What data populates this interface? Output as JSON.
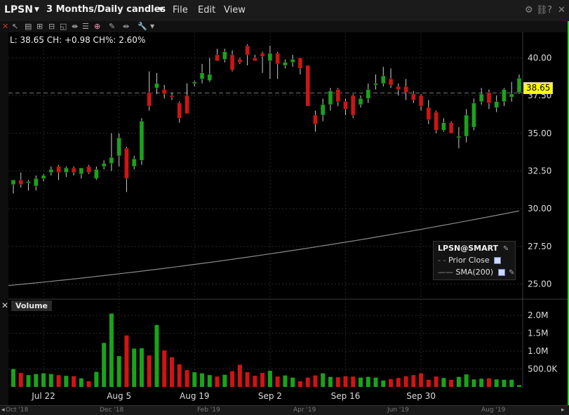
{
  "header": {
    "symbol": "LPSN",
    "period": "3 Months/Daily candles",
    "menus": [
      "File",
      "Edit",
      "View"
    ],
    "icons": [
      "gear-icon",
      "link-icon",
      "help-icon",
      "close-icon"
    ]
  },
  "toolbar": {
    "icons": [
      "close-icon",
      "cursor-icon",
      "bar-type-icon",
      "zoom-in-icon",
      "zoom-out-icon",
      "crosshair-icon",
      "annotation-icon",
      "split-icon",
      "tools-icon",
      "dropdown-icon"
    ]
  },
  "ohlc_readout": "L: 38.65 CH: +0.98 CH%: 2.60%",
  "last_price_tag": "38.65",
  "legend": {
    "title": "LPSN@SMART",
    "prior_close": "Prior Close",
    "sma": "SMA(200)"
  },
  "volume_label": "Volume",
  "timeline": {
    "labels": [
      "Oct '18",
      "Dec '18",
      "Feb '19",
      "Apr '19",
      "Jun '19",
      "Aug '19"
    ]
  },
  "colors": {
    "up": "#1aa31a",
    "down": "#d01414",
    "price_tag": "#ffff00",
    "sma": "#888888",
    "right_edge": "#22e022"
  },
  "chart_data": {
    "type": "candlestick",
    "price_axis": {
      "min": 24,
      "max": 41.6,
      "ticks": [
        "25.00",
        "27.50",
        "30.00",
        "32.50",
        "35.00",
        "37.50",
        "40.00"
      ]
    },
    "volume_axis": {
      "min": 0,
      "max": 2100000,
      "ticks": [
        "500.0K",
        "1.0M",
        "1.5M",
        "2.0M"
      ]
    },
    "x_labels": [
      "Jul 22",
      "Aug 5",
      "Aug 19",
      "Sep 2",
      "Sep 16",
      "Sep 30"
    ],
    "x_label_index": [
      4,
      14,
      24,
      34,
      44,
      54
    ],
    "prior_close": 37.67,
    "sma200": {
      "start": 24.9,
      "end": 29.85
    },
    "candles": [
      {
        "o": 31.6,
        "h": 31.8,
        "l": 31.0,
        "c": 31.9,
        "v": 500000
      },
      {
        "o": 31.9,
        "h": 32.4,
        "l": 31.4,
        "c": 31.6,
        "v": 390000
      },
      {
        "o": 31.7,
        "h": 31.9,
        "l": 31.2,
        "c": 31.8,
        "v": 330000
      },
      {
        "o": 31.5,
        "h": 32.2,
        "l": 31.2,
        "c": 32.0,
        "v": 360000
      },
      {
        "o": 32.0,
        "h": 32.3,
        "l": 31.8,
        "c": 32.2,
        "v": 380000
      },
      {
        "o": 32.4,
        "h": 32.8,
        "l": 32.2,
        "c": 32.6,
        "v": 360000
      },
      {
        "o": 32.8,
        "h": 32.9,
        "l": 31.9,
        "c": 32.4,
        "v": 330000
      },
      {
        "o": 32.4,
        "h": 32.8,
        "l": 32.1,
        "c": 32.7,
        "v": 310000
      },
      {
        "o": 32.7,
        "h": 32.8,
        "l": 32.2,
        "c": 32.4,
        "v": 300000
      },
      {
        "o": 32.3,
        "h": 32.7,
        "l": 32.0,
        "c": 32.7,
        "v": 240000
      },
      {
        "o": 32.8,
        "h": 32.9,
        "l": 32.3,
        "c": 32.4,
        "v": 160000
      },
      {
        "o": 32.0,
        "h": 32.8,
        "l": 31.9,
        "c": 32.6,
        "v": 420000
      },
      {
        "o": 32.8,
        "h": 33.2,
        "l": 32.6,
        "c": 33.0,
        "v": 1230000
      },
      {
        "o": 33.0,
        "h": 35.0,
        "l": 32.5,
        "c": 33.4,
        "v": 2050000
      },
      {
        "o": 33.5,
        "h": 35.0,
        "l": 32.8,
        "c": 34.7,
        "v": 860000
      },
      {
        "o": 34.0,
        "h": 34.1,
        "l": 31.1,
        "c": 32.0,
        "v": 1440000
      },
      {
        "o": 32.8,
        "h": 33.5,
        "l": 32.6,
        "c": 33.3,
        "v": 1070000
      },
      {
        "o": 33.2,
        "h": 36.0,
        "l": 32.9,
        "c": 35.8,
        "v": 1080000
      },
      {
        "o": 37.7,
        "h": 39.1,
        "l": 36.5,
        "c": 36.8,
        "v": 880000
      },
      {
        "o": 38.0,
        "h": 39.0,
        "l": 37.6,
        "c": 38.3,
        "v": 1730000
      },
      {
        "o": 37.9,
        "h": 38.2,
        "l": 37.3,
        "c": 37.6,
        "v": 1020000
      },
      {
        "o": 37.5,
        "h": 37.7,
        "l": 37.2,
        "c": 37.4,
        "v": 830000
      },
      {
        "o": 37.0,
        "h": 37.1,
        "l": 35.7,
        "c": 36.0,
        "v": 630000
      },
      {
        "o": 37.5,
        "h": 38.3,
        "l": 36.3,
        "c": 36.3,
        "v": 470000
      },
      {
        "o": 38.3,
        "h": 38.5,
        "l": 38.1,
        "c": 38.4,
        "v": 410000
      },
      {
        "o": 38.6,
        "h": 39.6,
        "l": 38.3,
        "c": 39.0,
        "v": 380000
      },
      {
        "o": 38.5,
        "h": 40.0,
        "l": 38.4,
        "c": 38.9,
        "v": 330000
      },
      {
        "o": 40.2,
        "h": 40.6,
        "l": 39.8,
        "c": 39.8,
        "v": 290000
      },
      {
        "o": 39.9,
        "h": 40.6,
        "l": 39.7,
        "c": 40.4,
        "v": 340000
      },
      {
        "o": 40.2,
        "h": 40.5,
        "l": 39.1,
        "c": 39.2,
        "v": 440000
      },
      {
        "o": 39.9,
        "h": 40.0,
        "l": 39.6,
        "c": 39.7,
        "v": 620000
      },
      {
        "o": 40.8,
        "h": 40.9,
        "l": 39.5,
        "c": 40.2,
        "v": 410000
      },
      {
        "o": 40.0,
        "h": 40.2,
        "l": 39.9,
        "c": 39.8,
        "v": 310000
      },
      {
        "o": 40.3,
        "h": 40.4,
        "l": 39.0,
        "c": 40.1,
        "v": 390000
      },
      {
        "o": 39.8,
        "h": 40.8,
        "l": 38.6,
        "c": 40.3,
        "v": 450000
      },
      {
        "o": 40.3,
        "h": 40.4,
        "l": 38.6,
        "c": 39.6,
        "v": 290000
      },
      {
        "o": 39.5,
        "h": 39.9,
        "l": 39.3,
        "c": 39.7,
        "v": 320000
      },
      {
        "o": 39.7,
        "h": 40.2,
        "l": 39.4,
        "c": 39.9,
        "v": 260000
      },
      {
        "o": 40.0,
        "h": 40.0,
        "l": 38.9,
        "c": 39.3,
        "v": 160000
      },
      {
        "o": 39.5,
        "h": 39.5,
        "l": 36.8,
        "c": 36.8,
        "v": 260000
      },
      {
        "o": 36.2,
        "h": 36.5,
        "l": 35.1,
        "c": 35.6,
        "v": 320000
      },
      {
        "o": 36.2,
        "h": 37.3,
        "l": 35.8,
        "c": 36.9,
        "v": 380000
      },
      {
        "o": 36.9,
        "h": 38.0,
        "l": 36.5,
        "c": 37.8,
        "v": 280000
      },
      {
        "o": 37.9,
        "h": 38.0,
        "l": 36.8,
        "c": 37.1,
        "v": 270000
      },
      {
        "o": 37.1,
        "h": 37.3,
        "l": 36.2,
        "c": 36.6,
        "v": 300000
      },
      {
        "o": 37.5,
        "h": 37.6,
        "l": 36.0,
        "c": 36.2,
        "v": 290000
      },
      {
        "o": 36.9,
        "h": 37.5,
        "l": 36.7,
        "c": 37.3,
        "v": 260000
      },
      {
        "o": 37.3,
        "h": 38.3,
        "l": 37.0,
        "c": 37.9,
        "v": 280000
      },
      {
        "o": 38.2,
        "h": 38.9,
        "l": 37.9,
        "c": 38.3,
        "v": 260000
      },
      {
        "o": 38.3,
        "h": 39.4,
        "l": 38.1,
        "c": 38.8,
        "v": 180000
      },
      {
        "o": 38.6,
        "h": 39.3,
        "l": 38.0,
        "c": 38.2,
        "v": 220000
      },
      {
        "o": 38.1,
        "h": 38.3,
        "l": 37.5,
        "c": 37.9,
        "v": 250000
      },
      {
        "o": 38.1,
        "h": 38.6,
        "l": 37.2,
        "c": 37.7,
        "v": 300000
      },
      {
        "o": 37.6,
        "h": 37.8,
        "l": 37.0,
        "c": 37.2,
        "v": 330000
      },
      {
        "o": 37.5,
        "h": 37.6,
        "l": 36.5,
        "c": 36.8,
        "v": 380000
      },
      {
        "o": 36.7,
        "h": 37.2,
        "l": 35.6,
        "c": 35.9,
        "v": 200000
      },
      {
        "o": 36.4,
        "h": 36.5,
        "l": 35.0,
        "c": 35.2,
        "v": 290000
      },
      {
        "o": 35.2,
        "h": 36.0,
        "l": 35.1,
        "c": 35.7,
        "v": 250000
      },
      {
        "o": 35.7,
        "h": 35.8,
        "l": 35.0,
        "c": 35.0,
        "v": 200000
      },
      {
        "o": 34.7,
        "h": 35.4,
        "l": 34.0,
        "c": 34.8,
        "v": 280000
      },
      {
        "o": 34.8,
        "h": 36.6,
        "l": 34.4,
        "c": 36.2,
        "v": 350000
      },
      {
        "o": 35.4,
        "h": 37.3,
        "l": 35.2,
        "c": 37.0,
        "v": 210000
      },
      {
        "o": 37.1,
        "h": 38.0,
        "l": 36.9,
        "c": 37.6,
        "v": 230000
      },
      {
        "o": 37.7,
        "h": 37.9,
        "l": 36.6,
        "c": 37.0,
        "v": 240000
      },
      {
        "o": 36.7,
        "h": 37.5,
        "l": 36.4,
        "c": 37.1,
        "v": 210000
      },
      {
        "o": 37.1,
        "h": 38.0,
        "l": 36.8,
        "c": 37.9,
        "v": 200000
      },
      {
        "o": 37.4,
        "h": 38.4,
        "l": 37.1,
        "c": 37.6,
        "v": 200000
      },
      {
        "o": 37.7,
        "h": 38.9,
        "l": 37.6,
        "c": 38.65,
        "v": 50000
      }
    ]
  }
}
